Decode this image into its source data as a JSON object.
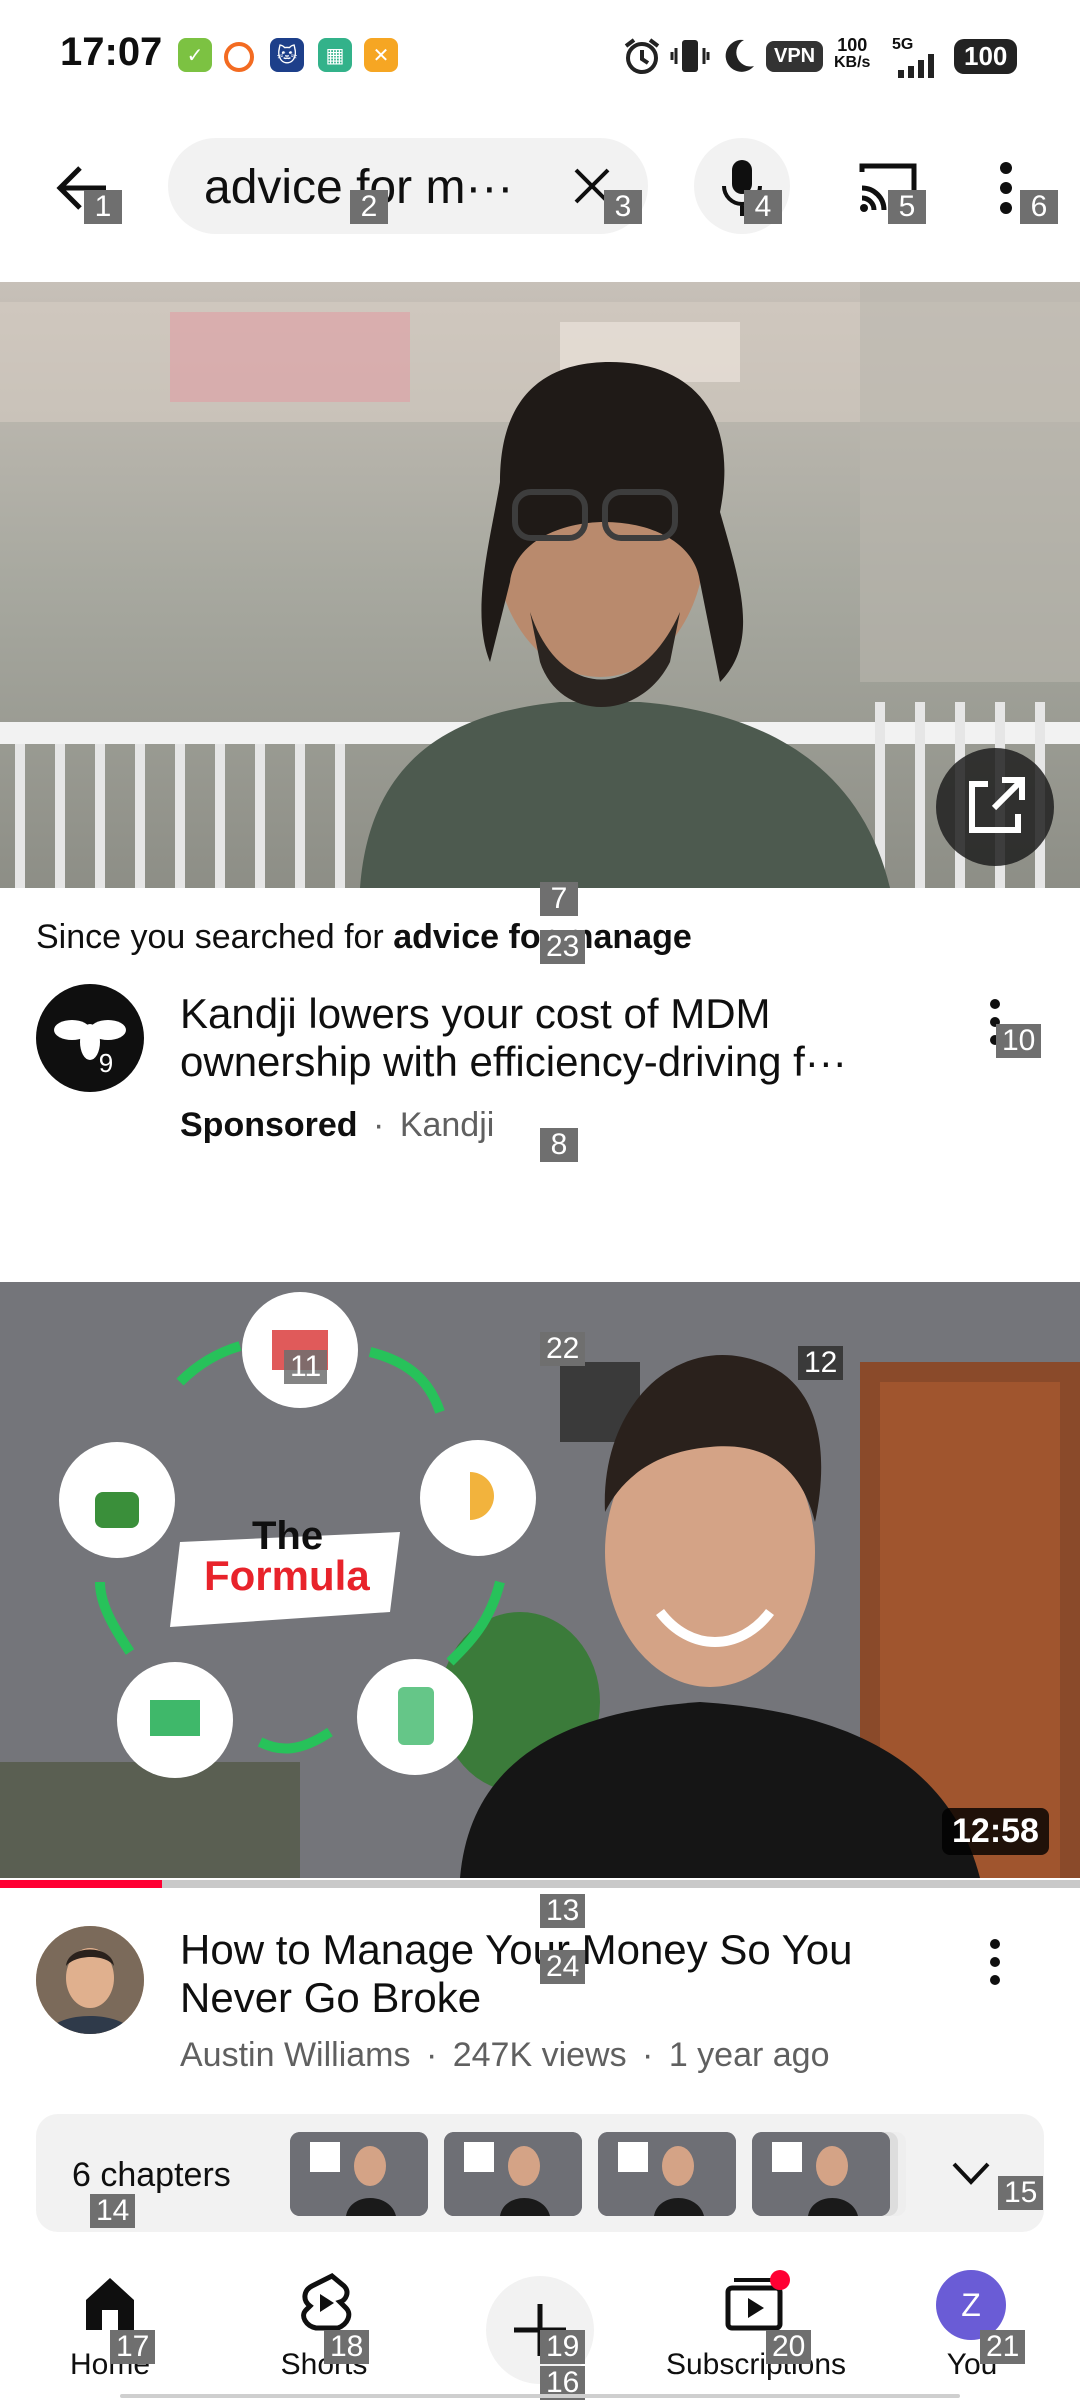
{
  "status_bar": {
    "time": "17:07",
    "vpn": "VPN",
    "speed_value": "100",
    "speed_unit": "KB/s",
    "network": "5G",
    "battery": "100"
  },
  "search": {
    "query": "advice for m···"
  },
  "ad": {
    "since_prefix": "Since you searched for ",
    "since_query": "advice for manage",
    "title": "Kandji lowers your cost of MDM ownership with efficiency-driving f···",
    "sponsored": "Sponsored",
    "separator": "·",
    "advertiser": "Kandji"
  },
  "video": {
    "thumb_text_1": "The",
    "thumb_text_2": "Formula",
    "duration": "12:58",
    "progress_fraction": 0.15,
    "title": "How to Manage Your Money So You Never Go Broke",
    "channel": "Austin Williams",
    "sep": "·",
    "views": "247K views",
    "age": "1 year ago",
    "chapters_label": "6 chapters"
  },
  "nav": {
    "home": "Home",
    "shorts": "Shorts",
    "subscriptions": "Subscriptions",
    "you": "You",
    "you_initial": "Z"
  },
  "tags": [
    "1",
    "2",
    "3",
    "4",
    "5",
    "6",
    "7",
    "8",
    "9",
    "10",
    "11",
    "12",
    "13",
    "14",
    "15",
    "16",
    "17",
    "18",
    "19",
    "20",
    "21",
    "22",
    "23",
    "24"
  ],
  "colors": {
    "accent_red": "#ff0033",
    "avatar_purple": "#6a5cd6",
    "formula_red": "#e8232b"
  }
}
